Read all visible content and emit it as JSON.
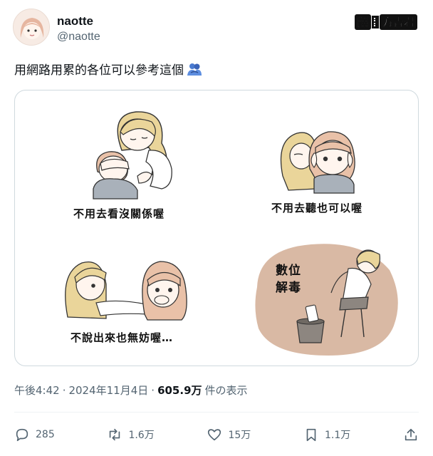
{
  "user": {
    "display_name": "naotte",
    "handle": "@naotte"
  },
  "watermark": {
    "left": "譯",
    "right": "方吉君"
  },
  "tweet": {
    "text": "用網路用累的各位可以參考這個",
    "emoji": "people-hugging-icon"
  },
  "media": {
    "captions": [
      "不用去看沒關係喔",
      "不用去聽也可以喔",
      "不說出來也無妨喔…",
      "數位",
      "解毒"
    ],
    "detox_bg_color": "#d9b9a4"
  },
  "meta": {
    "time": "午後4:42",
    "sep1": "·",
    "date": "2024年11月4日",
    "sep2": "·",
    "views": "605.9万",
    "views_suffix": "件の表示"
  },
  "actions": {
    "reply_count": "285",
    "repost_count": "1.6万",
    "like_count": "15万",
    "bookmark_count": "1.1万"
  },
  "colors": {
    "text": "#0f1419",
    "muted": "#536471",
    "border": "#cfd9de"
  }
}
